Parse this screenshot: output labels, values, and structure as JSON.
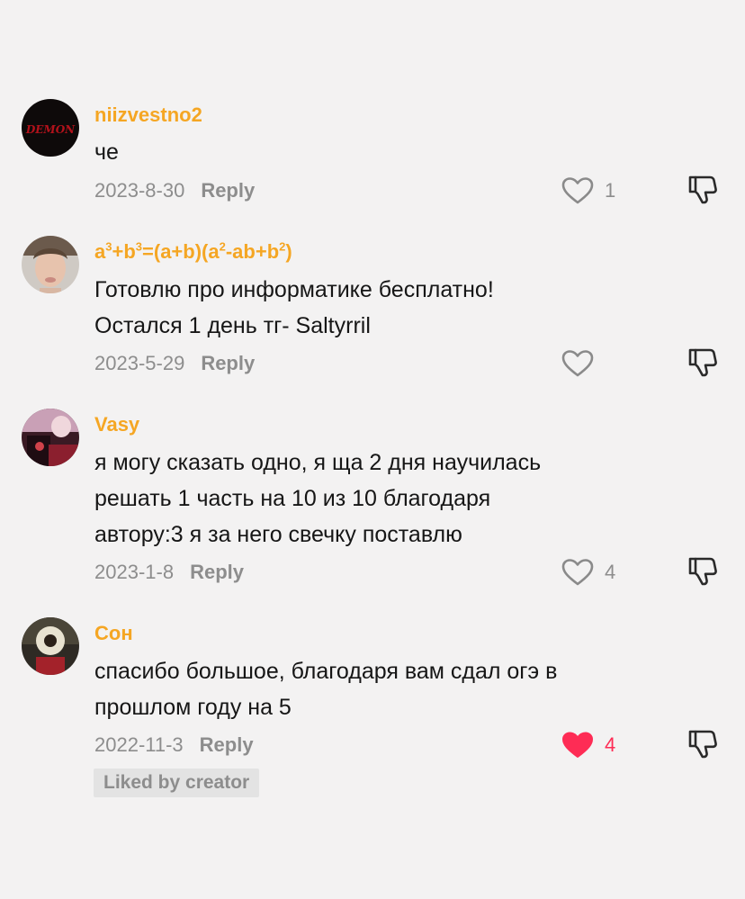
{
  "comments": [
    {
      "username": "niizvestno2",
      "avatar_text": "DEMON",
      "text_lines": [
        "че"
      ],
      "date": "2023-8-30",
      "reply_label": "Reply",
      "like_count": "1",
      "liked": false
    },
    {
      "username_parts": {
        "a": "a",
        "a_exp": "3",
        "plus_b": "+b",
        "b_exp": "3",
        "eq": "=(a+b)(a",
        "a2_exp": "2",
        "mid": "-ab+b",
        "b2_exp": "2",
        "end": ")"
      },
      "text_lines": [
        "Готовлю про информатике бесплатно!",
        "Остался 1 день тг- Saltyrril"
      ],
      "date": "2023-5-29",
      "reply_label": "Reply",
      "like_count": "",
      "liked": false
    },
    {
      "username": "Vasy",
      "text_lines": [
        "я могу сказать одно, я ща 2 дня научилась",
        "решать 1 часть на 10 из 10 благодаря",
        "автору:3 я за него свечку поставлю"
      ],
      "date": "2023-1-8",
      "reply_label": "Reply",
      "like_count": "4",
      "liked": false
    },
    {
      "username": "Сон",
      "text_lines": [
        "спасибо большое, благодаря вам сдал огэ в",
        "прошлом году на 5"
      ],
      "date": "2022-11-3",
      "reply_label": "Reply",
      "like_count": "4",
      "liked": true,
      "badge": "Liked by creator"
    }
  ],
  "colors": {
    "username": "#f5a623",
    "liked": "#fe2c55",
    "muted": "#8d8d8d",
    "text": "#161616",
    "background": "#f3f2f2"
  },
  "icons": {
    "like": "heart-outline-icon",
    "liked": "heart-filled-icon",
    "dislike": "thumbs-down-icon"
  }
}
